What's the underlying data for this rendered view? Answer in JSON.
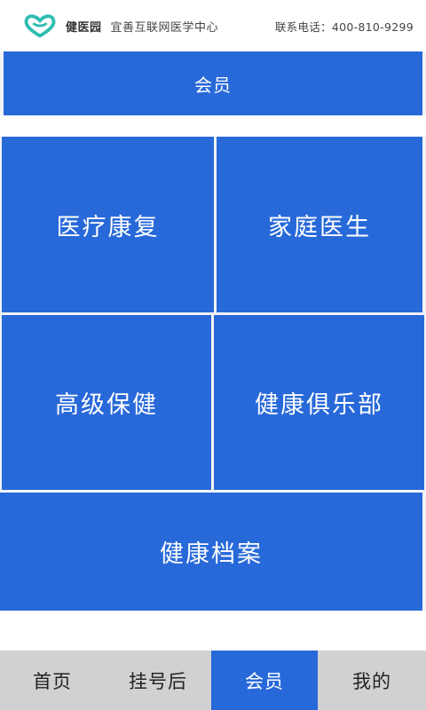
{
  "header": {
    "brand_name": "健医园",
    "slogan": "宜善互联网医学中心",
    "contact": "联系电话：400-810-9299",
    "accent_color": "#2ebdb0"
  },
  "page_title": "会员",
  "menu": {
    "tiles": [
      {
        "label": "医疗康复"
      },
      {
        "label": "家庭医生"
      },
      {
        "label": "高级保健"
      },
      {
        "label": "健康俱乐部"
      },
      {
        "label": "健康档案"
      }
    ],
    "tile_color": "#2869d9"
  },
  "tabs": {
    "items": [
      {
        "label": "首页"
      },
      {
        "label": "挂号后"
      },
      {
        "label": "会员"
      },
      {
        "label": "我的"
      }
    ],
    "active": "会员"
  }
}
